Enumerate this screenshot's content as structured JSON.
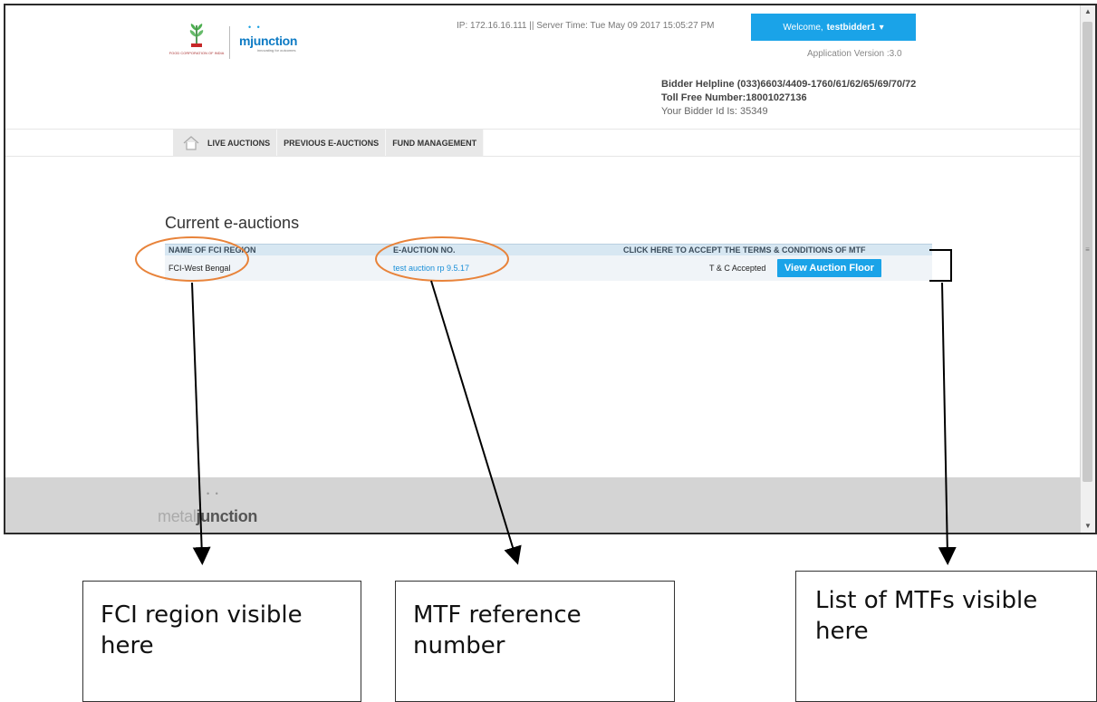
{
  "header": {
    "server_info": "IP: 172.16.16.111 || Server Time: Tue May 09 2017 15:05:27 PM",
    "welcome_prefix": "Welcome,",
    "welcome_user": "testbidder1",
    "app_version": "Application Version :3.0",
    "helpline": "Bidder Helpline (033)6603/4409-1760/61/62/65/69/70/72",
    "toll_free": "Toll Free Number:18001027136",
    "bidder_id": "Your Bidder Id Is: 35349",
    "fci_logo_text": "FOOD CORPORATION OF INDIA",
    "mjunction_logo": "mjunction",
    "mjunction_tagline": "innovating for outcomes"
  },
  "nav": {
    "live": "LIVE AUCTIONS",
    "previous": "PREVIOUS E-AUCTIONS",
    "fund": "FUND MANAGEMENT"
  },
  "main": {
    "title": "Current e-auctions",
    "columns": [
      "NAME OF FCI REGION",
      "E-AUCTION NO.",
      "CLICK HERE TO ACCEPT THE TERMS & CONDITIONS OF MTF"
    ],
    "rows": [
      {
        "region": "FCI-West Bengal",
        "auction_no": "test auction rp 9.5.17",
        "status": "T & C Accepted",
        "action": "View Auction Floor"
      }
    ]
  },
  "footer": {
    "logo_light": "metal",
    "logo_bold": "junction"
  },
  "annotations": {
    "region_note": "FCI region visible here",
    "mtf_note": "MTF reference number",
    "list_note": "List of MTFs visible here"
  },
  "colors": {
    "accent": "#1aa3e8",
    "table_header": "#d7e7f2",
    "highlight_ellipse": "#e8833a"
  }
}
